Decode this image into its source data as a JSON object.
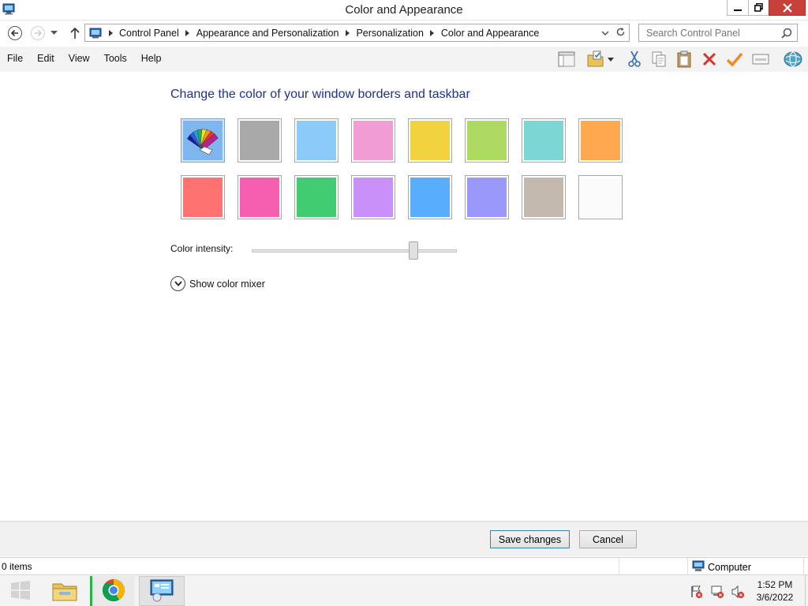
{
  "window": {
    "title": "Color and Appearance"
  },
  "address": {
    "breadcrumbs": [
      "Control Panel",
      "Appearance and Personalization",
      "Personalization",
      "Color and Appearance"
    ]
  },
  "search": {
    "placeholder": "Search Control Panel"
  },
  "menu": {
    "items": [
      "File",
      "Edit",
      "View",
      "Tools",
      "Help"
    ]
  },
  "main": {
    "heading": "Change the color of your window borders and taskbar",
    "swatches": [
      {
        "color": "auto",
        "selected": true
      },
      {
        "color": "#a9a9a9"
      },
      {
        "color": "#8ccbf9"
      },
      {
        "color": "#f19cd4"
      },
      {
        "color": "#f2d33f"
      },
      {
        "color": "#addb61"
      },
      {
        "color": "#7bd6d4"
      },
      {
        "color": "#ffa84f"
      },
      {
        "color": "#ff7272"
      },
      {
        "color": "#f65eaf"
      },
      {
        "color": "#42cc72"
      },
      {
        "color": "#c990f9"
      },
      {
        "color": "#58adfc"
      },
      {
        "color": "#9b98fb"
      },
      {
        "color": "#c3b8ae"
      },
      {
        "color": "#fbfbfb"
      }
    ],
    "intensity_label": "Color intensity:",
    "intensity_value": 0.79,
    "mixer_label": "Show color mixer"
  },
  "buttons": {
    "save": "Save changes",
    "cancel": "Cancel"
  },
  "status": {
    "items": "0 items",
    "location": "Computer"
  },
  "taskbar": {
    "time": "1:52 PM",
    "date": "3/6/2022"
  }
}
